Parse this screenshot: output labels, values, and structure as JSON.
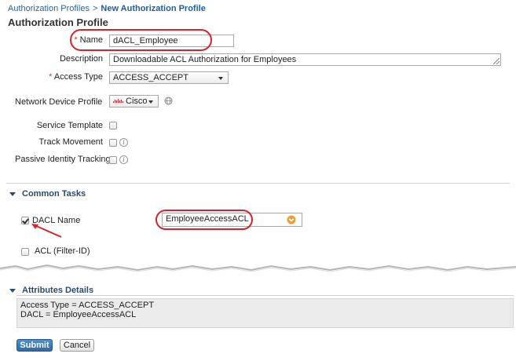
{
  "breadcrumb": {
    "parent": "Authorization Profiles",
    "separator": ">",
    "current": "New Authorization Profile"
  },
  "page_title": "Authorization Profile",
  "form": {
    "name_label": "Name",
    "name_value": "dACL_Employee",
    "description_label": "Description",
    "description_value": "Downloadable ACL Authorization for Employees",
    "access_type_label": "Access Type",
    "access_type_value": "ACCESS_ACCEPT",
    "network_device_profile_label": "Network Device Profile",
    "network_device_profile_value": "Cisco",
    "service_template_label": "Service Template",
    "track_movement_label": "Track Movement",
    "passive_identity_label": "Passive Identity Tracking",
    "required_marker": "*",
    "info_glyph": "i"
  },
  "common_tasks": {
    "title": "Common Tasks",
    "dacl_label": "DACL Name",
    "dacl_value": "EmployeeAccessACL",
    "dacl_checked": true,
    "acl_label": "ACL  (Filter-ID)",
    "acl_checked": false
  },
  "attributes": {
    "title": "Attributes Details",
    "line1": "Access Type = ACCESS_ACCEPT",
    "line2": "DACL = EmployeeAccessACL"
  },
  "buttons": {
    "submit": "Submit",
    "cancel": "Cancel"
  },
  "colors": {
    "highlight": "#d4232a",
    "link": "#2a6496",
    "section": "#2b4a6b",
    "submit": "#2f6aa5",
    "dropdown_toggle": "#e8a13a"
  },
  "icons": {
    "access_type_dropdown": "chevron-down-icon",
    "device_profile_dropdown": "chevron-down-icon",
    "device_profile_globe": "globe-icon",
    "device_profile_logo": "cisco-logo-icon",
    "dacl_dropdown": "chevron-down-icon",
    "section_toggle": "triangle-down-icon",
    "info": "info-icon",
    "annotation_arrow": "arrow-icon"
  }
}
